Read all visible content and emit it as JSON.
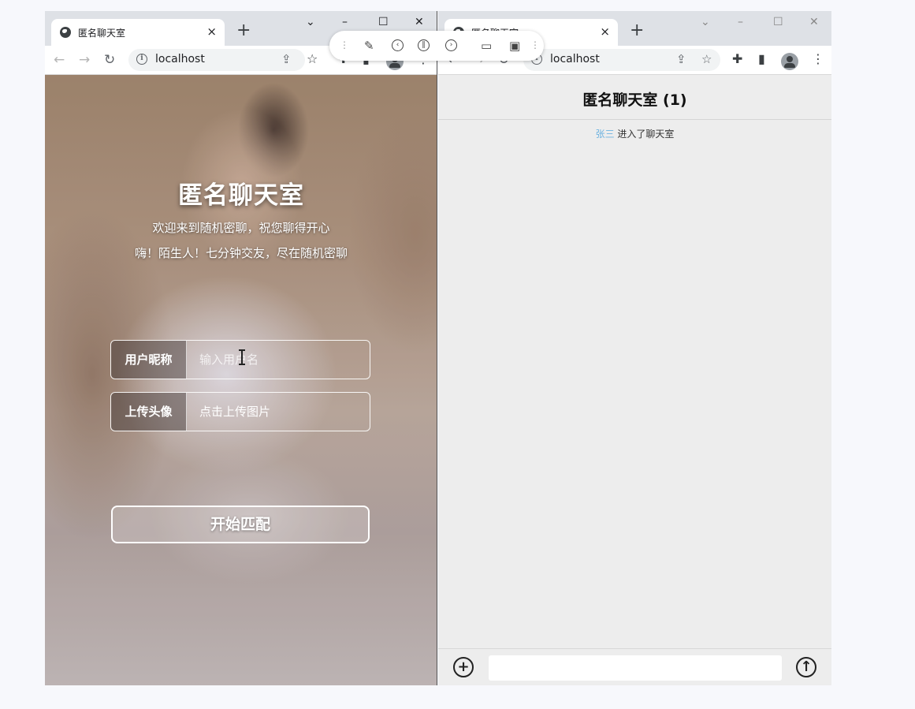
{
  "left_window": {
    "tab_title": "匿名聊天室",
    "tab_close": "×",
    "new_tab": "+",
    "address": "localhost",
    "controls": {
      "dropdown": "⌄",
      "minimize": "–",
      "maximize": "☐",
      "close": "✕"
    },
    "page": {
      "title": "匿名聊天室",
      "subtitle_1": "欢迎来到随机密聊，祝您聊得开心",
      "subtitle_2": "嗨！陌生人！七分钟交友，尽在随机密聊",
      "nickname_label": "用户昵称",
      "nickname_placeholder": "输入用户名",
      "avatar_label": "上传头像",
      "avatar_value": "点击上传图片",
      "match_button": "开始匹配"
    }
  },
  "right_window": {
    "tab_title": "匿名聊天室",
    "tab_close": "×",
    "new_tab": "+",
    "address": "localhost",
    "controls": {
      "dropdown": "⌄",
      "minimize": "–",
      "maximize": "☐",
      "close": "✕"
    },
    "chat": {
      "title": "匿名聊天室 (1)",
      "system_message": {
        "user": "张三",
        "text": " 进入了聊天室"
      },
      "message_placeholder": "",
      "add_button": "+",
      "send_button": "↑"
    }
  },
  "colors": {
    "chat_background": "#ededed",
    "join_user_color": "#6fb3e0",
    "tabstrip": "#dee1e6"
  }
}
